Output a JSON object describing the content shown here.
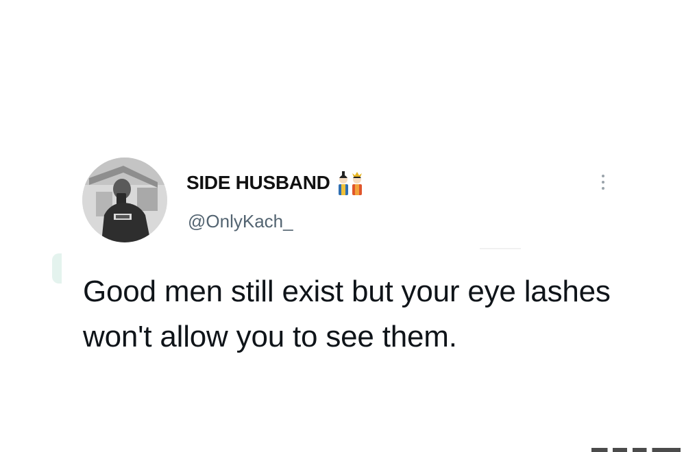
{
  "tweet": {
    "display_name": "SIDE HUSBAND",
    "name_emoji_icon": "couple-dolls-emoji-icon",
    "handle": "@OnlyKach_",
    "text": "Good men still exist but your eye lashes won't allow you to see them.",
    "more_icon": "vertical-ellipsis-icon",
    "avatar_icon": "profile-photo-avatar"
  },
  "colors": {
    "name": "#111111",
    "handle": "#536471",
    "text": "#0f1419",
    "background": "#ffffff"
  }
}
